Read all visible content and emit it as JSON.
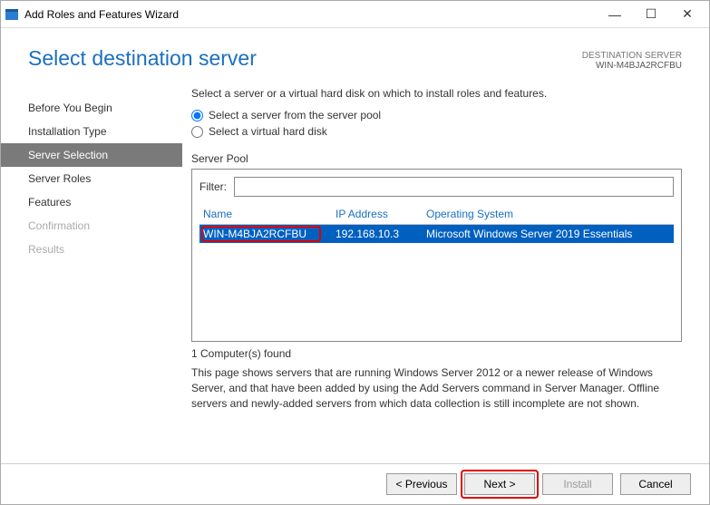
{
  "window": {
    "title": "Add Roles and Features Wizard"
  },
  "header": {
    "pageTitle": "Select destination server",
    "destLabel": "DESTINATION SERVER",
    "destValue": "WIN-M4BJA2RCFBU"
  },
  "steps": {
    "items": [
      {
        "label": "Before You Begin",
        "state": "normal"
      },
      {
        "label": "Installation Type",
        "state": "normal"
      },
      {
        "label": "Server Selection",
        "state": "active"
      },
      {
        "label": "Server Roles",
        "state": "normal"
      },
      {
        "label": "Features",
        "state": "normal"
      },
      {
        "label": "Confirmation",
        "state": "disabled"
      },
      {
        "label": "Results",
        "state": "disabled"
      }
    ]
  },
  "content": {
    "intro": "Select a server or a virtual hard disk on which to install roles and features.",
    "radio1": "Select a server from the server pool",
    "radio2": "Select a virtual hard disk",
    "poolLabel": "Server Pool",
    "filterLabel": "Filter:",
    "filterValue": "",
    "columns": {
      "name": "Name",
      "ip": "IP Address",
      "os": "Operating System"
    },
    "rows": [
      {
        "name": "WIN-M4BJA2RCFBU",
        "ip": "192.168.10.3",
        "os": "Microsoft Windows Server 2019 Essentials"
      }
    ],
    "countLabel": "1 Computer(s) found",
    "note": "This page shows servers that are running Windows Server 2012 or a newer release of Windows Server, and that have been added by using the Add Servers command in Server Manager. Offline servers and newly-added servers from which data collection is still incomplete are not shown."
  },
  "footer": {
    "previous": "< Previous",
    "next": "Next >",
    "install": "Install",
    "cancel": "Cancel"
  }
}
